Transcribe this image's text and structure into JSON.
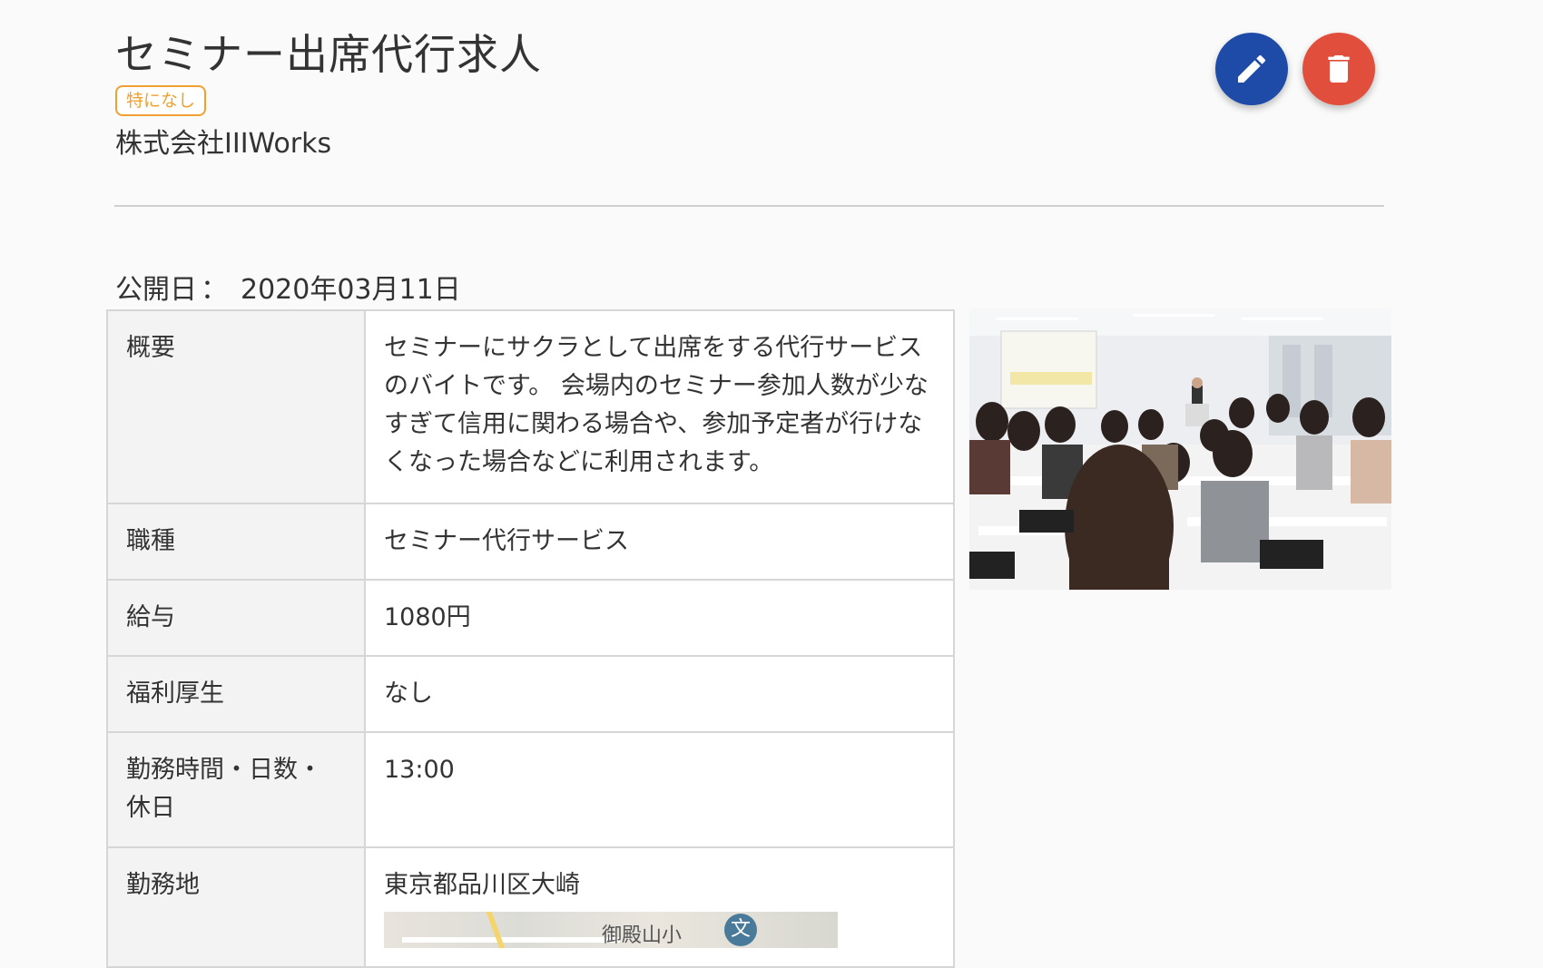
{
  "header": {
    "title": "セミナー出席代行求人",
    "badge": "特になし",
    "company": "株式会社IIIWorks"
  },
  "actions": {
    "edit_icon": "pencil-icon",
    "delete_icon": "trash-icon",
    "edit_color": "#1e4aa8",
    "delete_color": "#e24e3c"
  },
  "published": {
    "label": "公開日",
    "colon": "：",
    "date": "2020年03月11日"
  },
  "details": {
    "summary_label": "概要",
    "summary_value": "セミナーにサクラとして出席をする代行サービスのバイトです。 会場内のセミナー参加人数が少なすぎて信用に関わる場合や、参加予定者が行けなくなった場合などに利用されます。",
    "job_label": "職種",
    "job_value": "セミナー代行サービス",
    "salary_label": "給与",
    "salary_value": "1080円",
    "welfare_label": "福利厚生",
    "welfare_value": "なし",
    "hours_label": "勤務時間・日数・休日",
    "hours_value": "13:00",
    "location_label": "勤務地",
    "location_value": "東京都品川区大崎",
    "map_label": "御殿山小",
    "map_school_glyph": "文"
  },
  "photo": {
    "subject": "seminar-room-photo"
  }
}
